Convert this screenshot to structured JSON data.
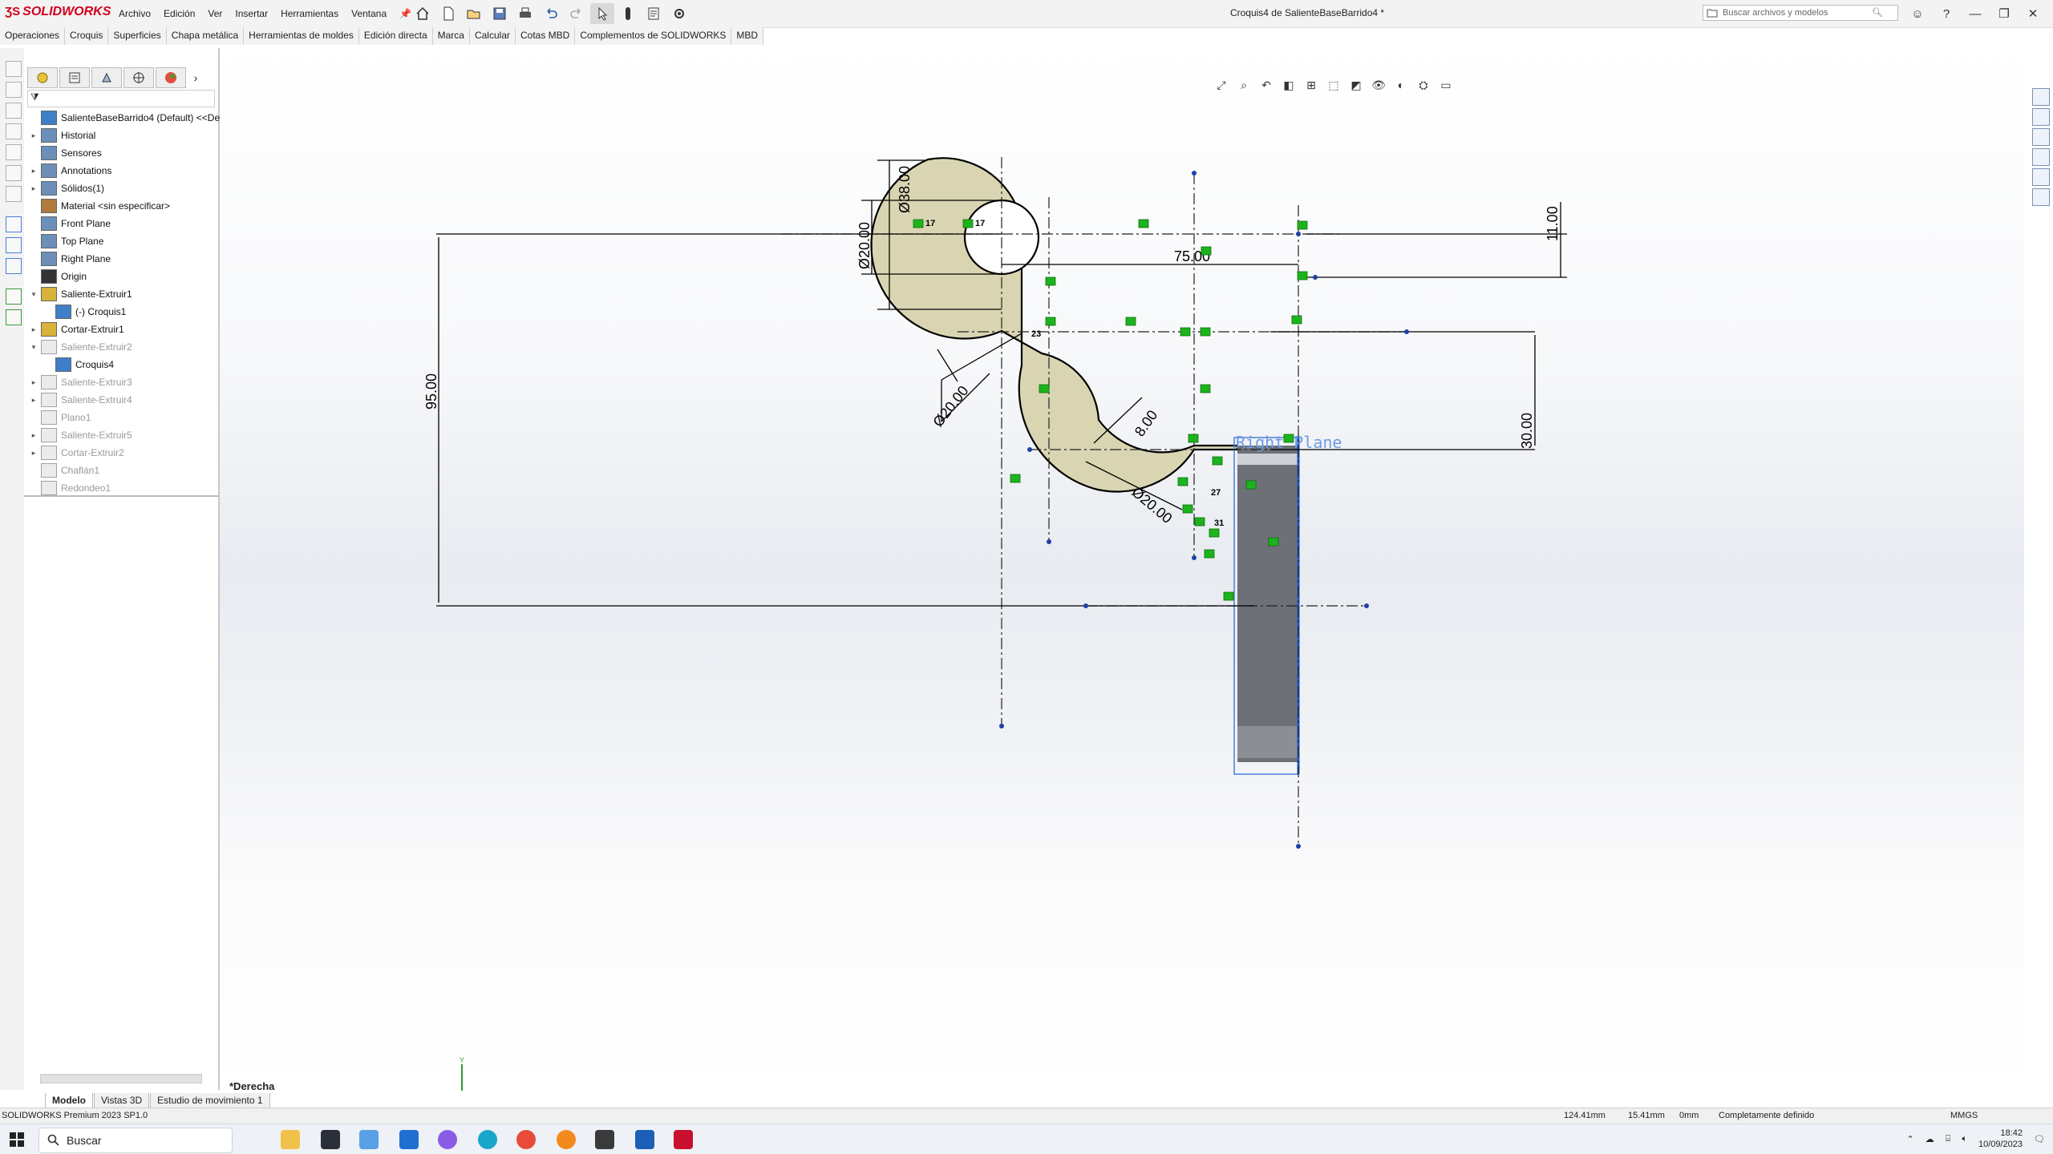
{
  "app": {
    "brand": "SOLIDWORKS",
    "window_title": "Croquis4 de SalienteBaseBarrido4 *"
  },
  "menu": [
    "Archivo",
    "Edición",
    "Ver",
    "Insertar",
    "Herramientas",
    "Ventana"
  ],
  "search": {
    "placeholder": "Buscar archivos y modelos"
  },
  "cm_tabs": [
    "Operaciones",
    "Croquis",
    "Superficies",
    "Chapa metálica",
    "Herramientas de moldes",
    "Edición directa",
    "Marca",
    "Calcular",
    "Cotas MBD",
    "Complementos de SOLIDWORKS",
    "MBD"
  ],
  "tree": [
    {
      "label": "SalienteBaseBarrido4 (Default) <<De",
      "icon": "part-icon",
      "arrow": ""
    },
    {
      "label": "Historial",
      "icon": "history-icon",
      "arrow": "▸"
    },
    {
      "label": "Sensores",
      "icon": "sensor-icon",
      "arrow": ""
    },
    {
      "label": "Annotations",
      "icon": "annotations-icon",
      "arrow": "▸"
    },
    {
      "label": "Sólidos(1)",
      "icon": "solid-bodies-icon",
      "arrow": "▸"
    },
    {
      "label": "Material <sin especificar>",
      "icon": "material-icon",
      "arrow": ""
    },
    {
      "label": "Front Plane",
      "icon": "plane-icon",
      "arrow": ""
    },
    {
      "label": "Top Plane",
      "icon": "plane-icon",
      "arrow": ""
    },
    {
      "label": "Right Plane",
      "icon": "plane-icon",
      "arrow": ""
    },
    {
      "label": "Origin",
      "icon": "origin-icon",
      "arrow": ""
    },
    {
      "label": "Saliente-Extruir1",
      "icon": "extrude-icon",
      "arrow": "▾"
    },
    {
      "label": "(-) Croquis1",
      "icon": "sketch-icon",
      "arrow": ""
    },
    {
      "label": "Cortar-Extruir1",
      "icon": "cut-extrude-icon",
      "arrow": "▸"
    },
    {
      "label": "Saliente-Extruir2",
      "icon": "extrude-icon",
      "arrow": "▾",
      "dim": true
    },
    {
      "label": "Croquis4",
      "icon": "sketch-icon",
      "arrow": ""
    },
    {
      "label": "Saliente-Extruir3",
      "icon": "extrude-icon",
      "arrow": "▸",
      "dim": true
    },
    {
      "label": "Saliente-Extruir4",
      "icon": "extrude-icon",
      "arrow": "▸",
      "dim": true
    },
    {
      "label": "Plano1",
      "icon": "plane-icon",
      "arrow": "",
      "dim": true
    },
    {
      "label": "Saliente-Extruir5",
      "icon": "extrude-icon",
      "arrow": "▸",
      "dim": true
    },
    {
      "label": "Cortar-Extruir2",
      "icon": "cut-extrude-icon",
      "arrow": "▸",
      "dim": true
    },
    {
      "label": "Chaflán1",
      "icon": "chamfer-icon",
      "arrow": "",
      "dim": true
    },
    {
      "label": "Redondeo1",
      "icon": "fillet-icon",
      "arrow": "",
      "dim": true
    }
  ],
  "bottom_tabs": [
    "Modelo",
    "Vistas 3D",
    "Estudio de movimiento 1"
  ],
  "view_label": "*Derecha",
  "status": {
    "product": "SOLIDWORKS Premium 2023 SP1.0",
    "x": "124.41mm",
    "y": "15.41mm",
    "z": "0mm",
    "state": "Completamente definido",
    "units": "MMGS"
  },
  "sketch": {
    "dimensions": [
      "Ø38.00",
      "Ø20.00",
      "75.00",
      "11.00",
      "95.00",
      "Ø20.00",
      "8.00",
      "Ø20.00",
      "30.00"
    ],
    "plane_label": "Right Plane",
    "relations": [
      "17",
      "17",
      "23",
      "27",
      "31"
    ]
  },
  "taskbar": {
    "search": "Buscar",
    "time": "18:42",
    "date": "10/09/2023"
  },
  "colors": {
    "sketch_fill": "#d9d5b2",
    "sketch_line": "#000000",
    "relation": "#1db31d",
    "plane": "#4a7fd6",
    "body": "#6e7078"
  }
}
